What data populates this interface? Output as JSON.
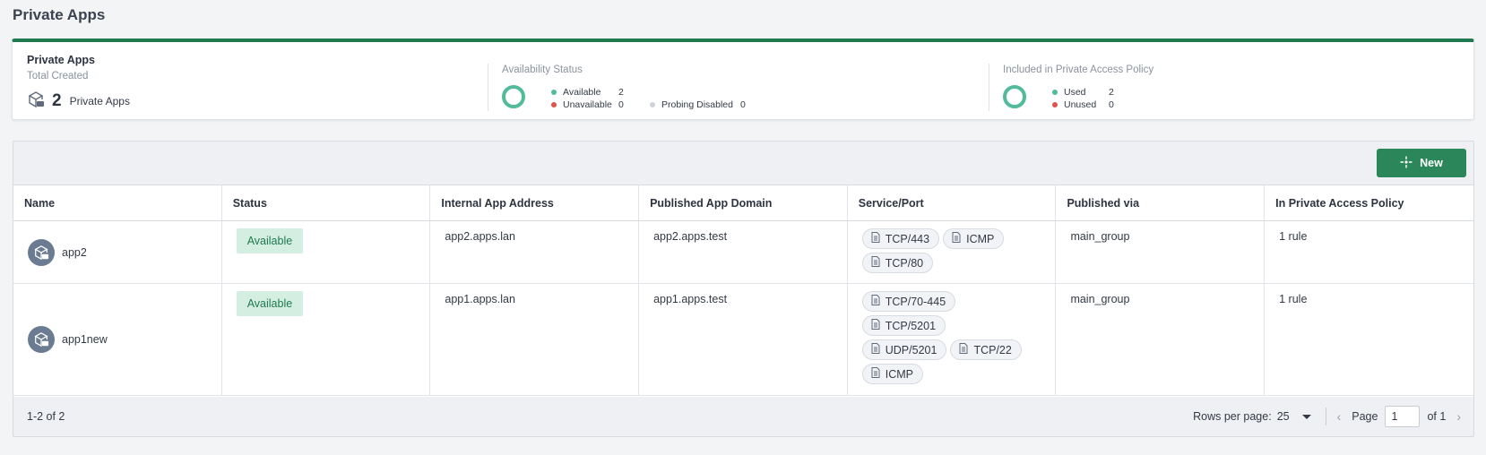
{
  "page": {
    "title": "Private Apps"
  },
  "summary": {
    "title": "Private Apps",
    "total_label": "Total Created",
    "count": "2",
    "count_label": "Private Apps",
    "availability": {
      "label": "Availability Status",
      "available_label": "Available",
      "available_value": "2",
      "unavailable_label": "Unavailable",
      "unavailable_value": "0",
      "probing_label": "Probing Disabled",
      "probing_value": "0"
    },
    "policy": {
      "label": "Included in Private Access Policy",
      "used_label": "Used",
      "used_value": "2",
      "unused_label": "Unused",
      "unused_value": "0"
    }
  },
  "toolbar": {
    "new_label": "New"
  },
  "table": {
    "columns": [
      "Name",
      "Status",
      "Internal App Address",
      "Published App Domain",
      "Service/Port",
      "Published via",
      "In Private Access Policy"
    ],
    "rows": [
      {
        "name": "app2",
        "status": "Available",
        "internal": "app2.apps.lan",
        "domain": "app2.apps.test",
        "services": [
          "TCP/443",
          "ICMP",
          "TCP/80"
        ],
        "via": "main_group",
        "policy": "1 rule"
      },
      {
        "name": "app1new",
        "status": "Available",
        "internal": "app1.apps.lan",
        "domain": "app1.apps.test",
        "services": [
          "TCP/70-445",
          "TCP/5201",
          "UDP/5201",
          "TCP/22",
          "ICMP"
        ],
        "via": "main_group",
        "policy": "1 rule"
      }
    ]
  },
  "pager": {
    "range": "1-2 of 2",
    "rows_label": "Rows per page:",
    "rows_value": "25",
    "page_label": "Page",
    "page_value": "1",
    "of_label": "of 1"
  },
  "colors": {
    "accent": "#217a4f",
    "button": "#2b8659",
    "available": "#52bc9a",
    "unavailable": "#e0524d",
    "disabled": "#cfd3d8"
  }
}
